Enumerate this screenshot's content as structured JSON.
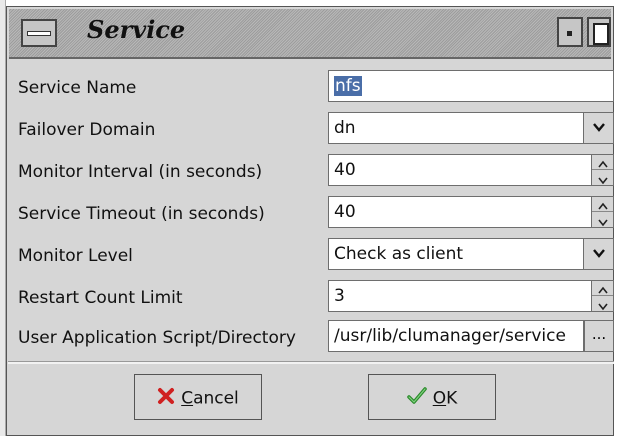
{
  "window": {
    "title": "Service"
  },
  "form": {
    "fields": [
      {
        "label": "Service Name",
        "value": "nfs"
      },
      {
        "label": "Failover Domain",
        "value": "dn"
      },
      {
        "label": "Monitor Interval (in seconds)",
        "value": "40"
      },
      {
        "label": "Service Timeout (in seconds)",
        "value": "40"
      },
      {
        "label": "Monitor Level",
        "value": "Check as client"
      },
      {
        "label": "Restart Count Limit",
        "value": "3"
      },
      {
        "label": "User Application Script/Directory",
        "value": "/usr/lib/clumanager/service",
        "browse_label": "..."
      }
    ]
  },
  "buttons": {
    "cancel_first": "C",
    "cancel_rest": "ancel",
    "ok_first": "O",
    "ok_rest": "K"
  },
  "colors": {
    "selection": "#4a6ea8",
    "cancel_icon": "#d02020",
    "ok_icon": "#2a8a2a"
  }
}
